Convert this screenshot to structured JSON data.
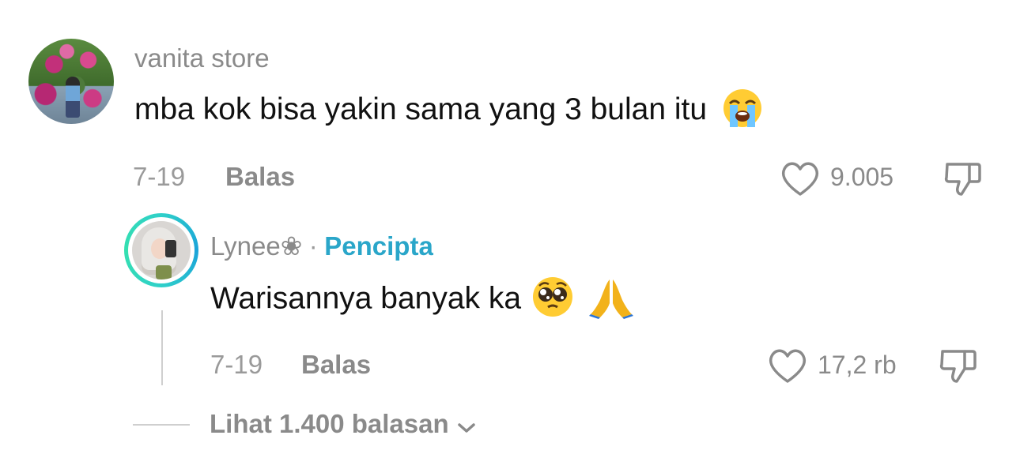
{
  "comments": [
    {
      "username": "vanita store",
      "text": "mba kok bisa yakin sama yang 3 bulan itu",
      "emoji": "loudly-crying-face",
      "date": "7-19",
      "reply_label": "Balas",
      "likes": "9.005"
    }
  ],
  "reply": {
    "username": "Lynee❀",
    "separator": "·",
    "badge": "Pencipta",
    "text": "Warisannya banyak ka",
    "emojis": [
      "pleading-face",
      "folded-hands"
    ],
    "date": "7-19",
    "reply_label": "Balas",
    "likes": "17,2 rb"
  },
  "view_more": {
    "label": "Lihat 1.400 balasan"
  },
  "colors": {
    "creator_badge": "#2aa6c9",
    "meta": "#9a9a9a"
  }
}
